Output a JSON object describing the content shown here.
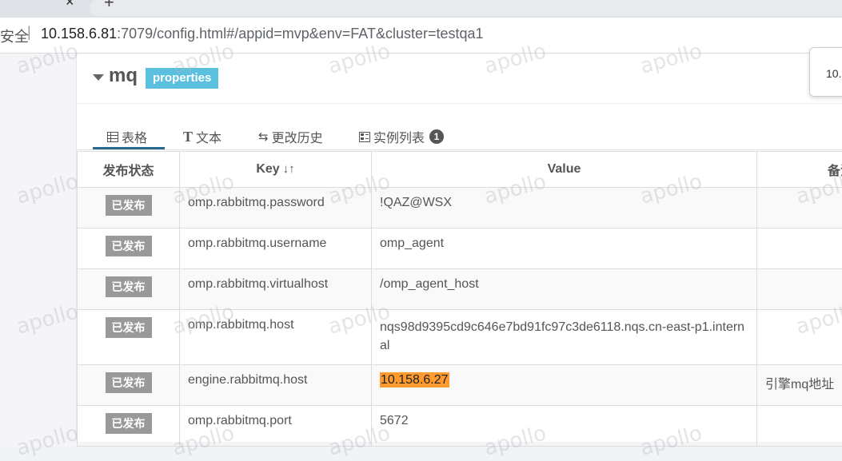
{
  "browser": {
    "tab_close": "×",
    "new_tab": "+",
    "security_prefix": "安全",
    "url_host": "10.158.6.81",
    "url_rest": ":7079/config.html#/appid=mvp&env=FAT&cluster=testqa1"
  },
  "namespace": {
    "name": "mq",
    "format": "properties",
    "tooltip_text": "10."
  },
  "tabs": [
    {
      "label": "表格",
      "icon": "table-icon"
    },
    {
      "label": "文本",
      "icon": "text-icon"
    },
    {
      "label": "更改历史",
      "icon": "history-icon"
    },
    {
      "label": "实例列表",
      "icon": "instance-icon",
      "badge": "1"
    }
  ],
  "table": {
    "headers": {
      "status": "发布状态",
      "key": "Key",
      "value": "Value",
      "comment": "备注"
    },
    "rows": [
      {
        "status": "已发布",
        "key": "omp.rabbitmq.password",
        "value": "!QAZ@WSX",
        "comment": ""
      },
      {
        "status": "已发布",
        "key": "omp.rabbitmq.username",
        "value": "omp_agent",
        "comment": ""
      },
      {
        "status": "已发布",
        "key": "omp.rabbitmq.virtualhost",
        "value": "/omp_agent_host",
        "comment": ""
      },
      {
        "status": "已发布",
        "key": "omp.rabbitmq.host",
        "value": "nqs98d9395cd9c646e7bd91fc97c3de6118.nqs.cn-east-p1.internal",
        "comment": ""
      },
      {
        "status": "已发布",
        "key": "engine.rabbitmq.host",
        "value": "10.158.6.27",
        "comment": "引擎mq地址"
      },
      {
        "status": "已发布",
        "key": "omp.rabbitmq.port",
        "value": "5672",
        "comment": ""
      }
    ]
  },
  "watermark": "apollo",
  "colors": {
    "badge": "#5bc0de",
    "status_tag": "#999999",
    "highlight": "#ff9b2e",
    "tab_active": "#2b6a8f"
  }
}
